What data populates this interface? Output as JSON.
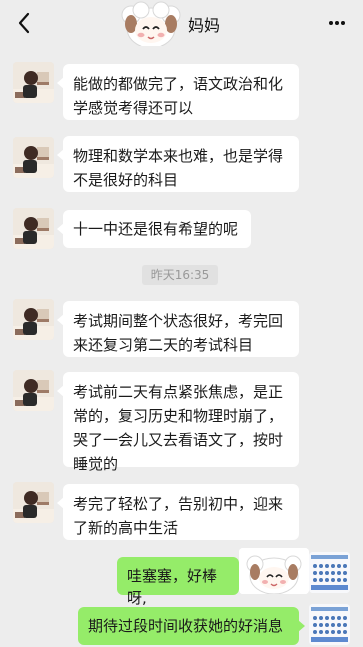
{
  "header": {
    "title": "妈妈",
    "back_icon": "chevron-left-icon",
    "more_icon": "more-dots-icon",
    "sticker_icon": "sheep-sticker-icon"
  },
  "messages": [
    {
      "side": "left",
      "text": "能做的都做完了，语文政治和化学感觉考得还可以"
    },
    {
      "side": "left",
      "text": "物理和数学本来也难，也是学得不是很好的科目"
    },
    {
      "side": "left",
      "text": "十一中还是很有希望的呢"
    },
    {
      "side": "left",
      "text": "考试期间整个状态很好，考完回来还复习第二天的考试科目"
    },
    {
      "side": "left",
      "text": "考试前二天有点紧张焦虑，是正常的，复习历史和物理时崩了，哭了一会儿又去看语文了，按时睡觉的"
    },
    {
      "side": "left",
      "text": "考完了轻松了，告别初中，迎来了新的高中生活"
    },
    {
      "side": "right",
      "text": "哇塞塞，好棒呀,"
    },
    {
      "side": "right",
      "text": "期待过段时间收获她的好消息"
    }
  ],
  "timestamp": "昨天16:35",
  "colors": {
    "background": "#ededed",
    "bubble_left": "#ffffff",
    "bubble_right": "#95ec69"
  }
}
